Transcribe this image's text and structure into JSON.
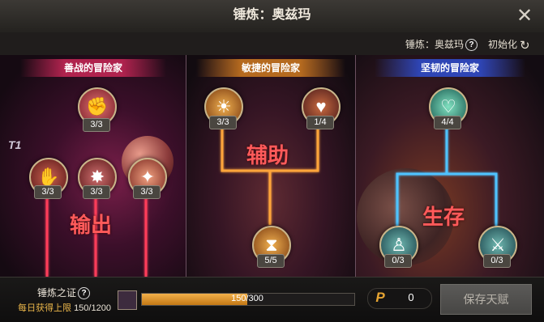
{
  "window": {
    "title": "锤炼：奥兹玛",
    "close_icon": "close-icon"
  },
  "subbar": {
    "info_label": "锤炼：奥兹玛",
    "reset_label": "初始化"
  },
  "tier_label": "T1",
  "columns": [
    {
      "header": "善战的冒险家",
      "accent": "#b0234e",
      "banner": "输出"
    },
    {
      "header": "敏捷的冒险家",
      "accent": "#b56a1f",
      "banner": "辅助"
    },
    {
      "header": "坚韧的冒险家",
      "accent": "#2e45b5",
      "banner": "生存"
    }
  ],
  "nodes": [
    {
      "icon": "fist-icon",
      "count": "3/3"
    },
    {
      "icon": "beast-claw-icon",
      "count": "3/3"
    },
    {
      "icon": "shattered-blade-icon",
      "count": "3/3"
    },
    {
      "icon": "fire-cloak-icon",
      "count": "3/3"
    },
    {
      "icon": "energy-hand-icon",
      "count": "3/3"
    },
    {
      "icon": "heart-shield-icon",
      "count": "1/4"
    },
    {
      "icon": "hourglass-icon",
      "count": "5/5"
    },
    {
      "icon": "heart-armor-icon",
      "count": "4/4"
    },
    {
      "icon": "muscle-man-icon",
      "count": "0/3"
    },
    {
      "icon": "crossed-swords-icon",
      "count": "0/3"
    }
  ],
  "footer": {
    "proof_label": "锤炼之证",
    "daily_label": "每日获得上限",
    "daily_value": "150/1200",
    "progress_text": "150/300",
    "progress": 0.5,
    "points_icon": "P",
    "points_value": "0",
    "save_label": "保存天赋"
  },
  "colors": {
    "damage_line": "#ff3c5a",
    "support_line": "#ffa53a",
    "survival_line": "#4fc3ff",
    "progress_fill": "#e9a03a"
  }
}
